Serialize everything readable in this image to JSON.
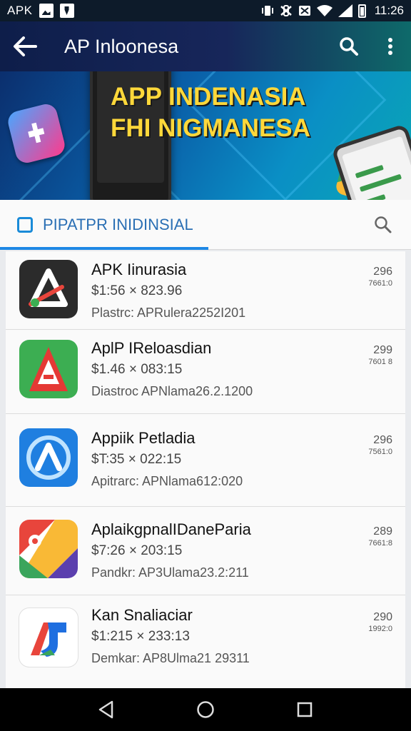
{
  "status_bar": {
    "brand": "APK",
    "time": "11:26"
  },
  "app_bar": {
    "title": "AP Inloonesa"
  },
  "banner": {
    "line1": "APP INDENASIA",
    "line2": "FHI NIGMANESA"
  },
  "tab": {
    "label": "PIPATPR INIDINSIAL"
  },
  "apps": [
    {
      "name": "APK Iinurasia",
      "price": "$1:56 × 823.96",
      "meta": "Plastrc: APRulera2252I201",
      "count": "296",
      "sub": "7661:0",
      "icon": "apk-triangle-icon",
      "color": "#2b2b2b"
    },
    {
      "name": "AplP IReloasdian",
      "price": "$1.46 × 083:15",
      "meta": "Diastroc APNlama26.2.1200",
      "count": "299",
      "sub": "7601 8",
      "icon": "red-a-icon",
      "color": "#3cae52"
    },
    {
      "name": "Appiik Petladia",
      "price": "$T:35 × 022:15",
      "meta": "Apitrarc: APNlama612:020",
      "count": "296",
      "sub": "7561:0",
      "icon": "blue-a-icon",
      "color": "#1f7fe0"
    },
    {
      "name": "AplaikgpnalIDaneParia",
      "price": "$7:26 × 203:15",
      "meta": "Pandkr: AP3Ulama23.2:211",
      "count": "289",
      "sub": "7661:8",
      "icon": "multicolor-arrow-icon",
      "color": "#e8453c"
    },
    {
      "name": "Kan Snaliaciar",
      "price": "$1:215 × 233:13",
      "meta": "Demkar: AP8Ulma21 29311",
      "count": "290",
      "sub": "1992:0",
      "icon": "colored-j-icon",
      "color": "#1f6fe0"
    }
  ]
}
